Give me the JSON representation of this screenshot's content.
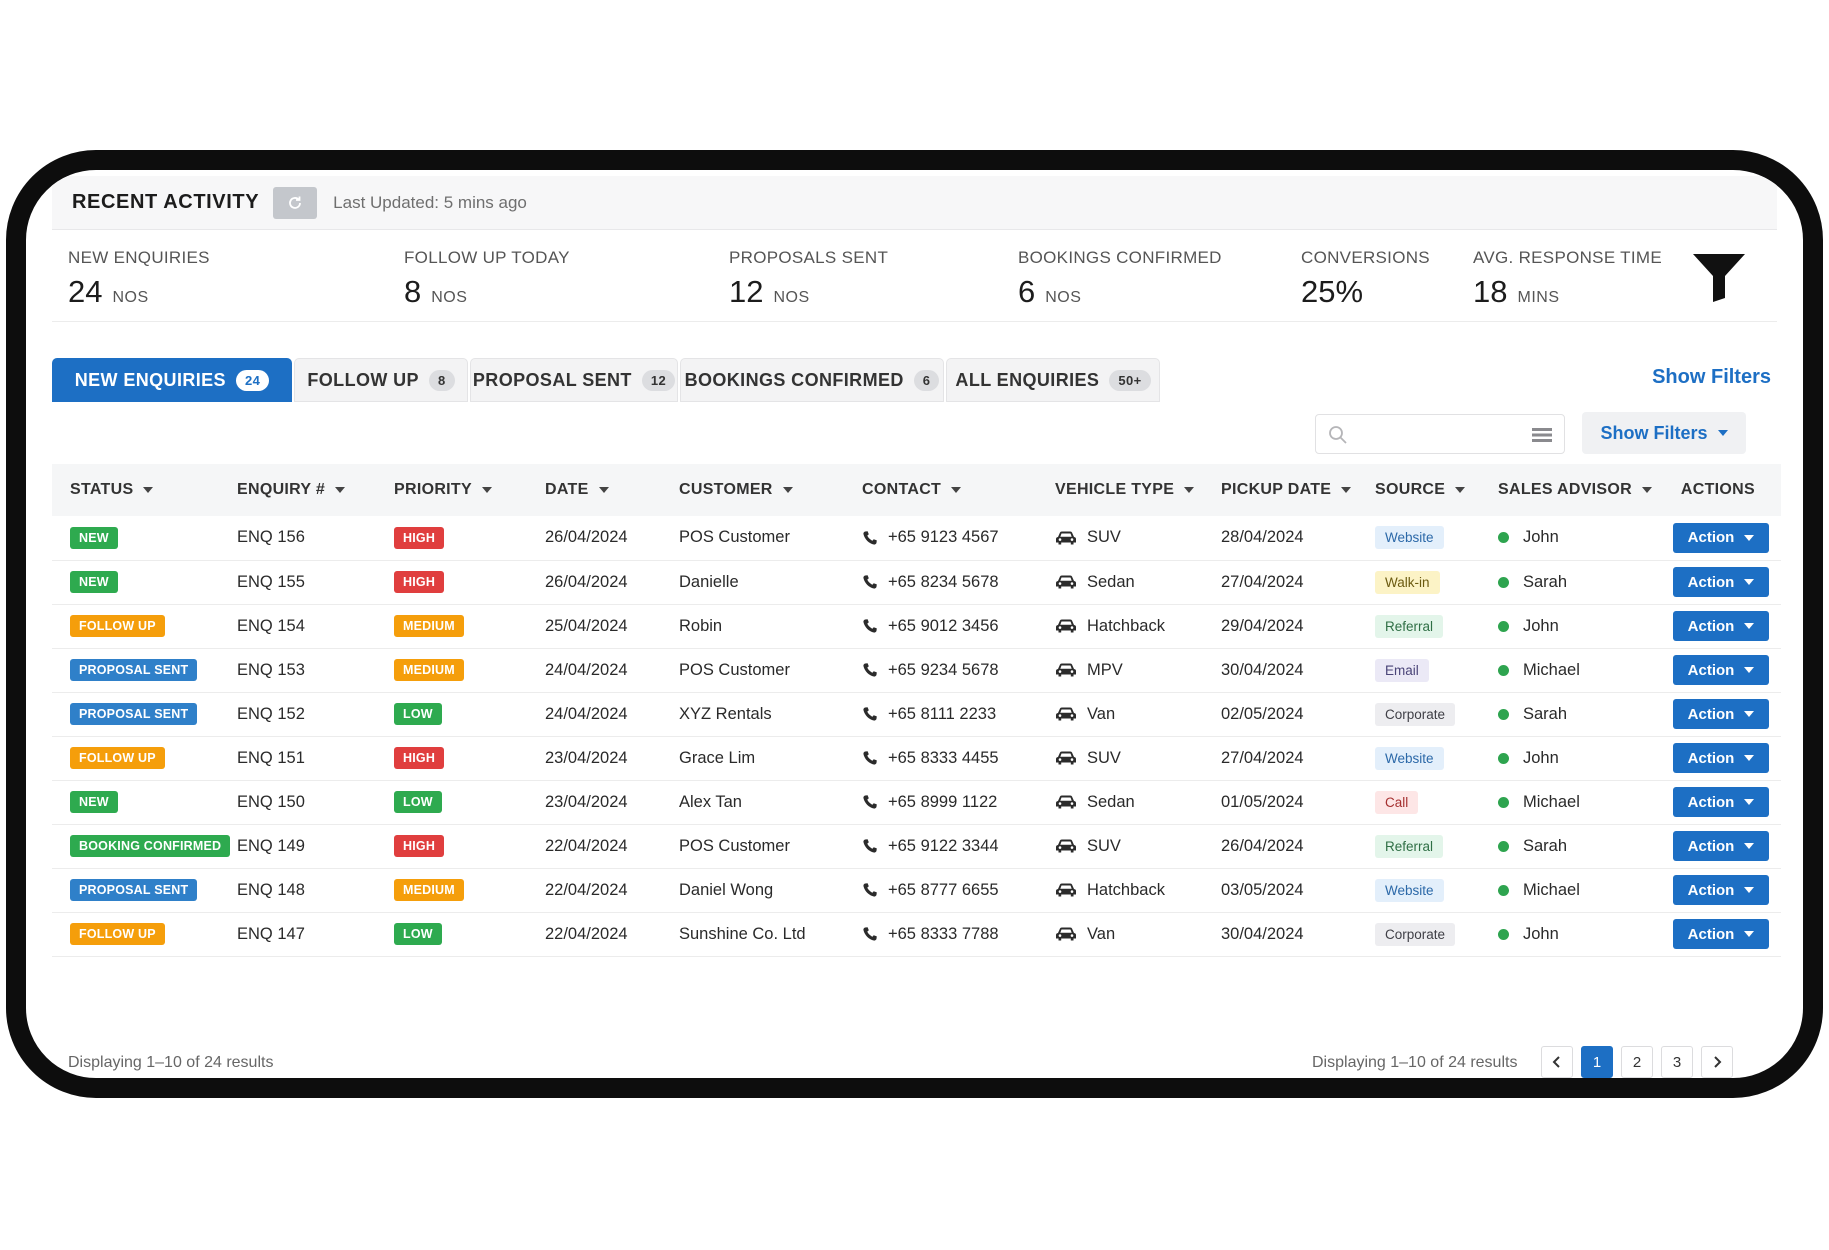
{
  "header": {
    "title": "RECENT ACTIVITY",
    "refresh_icon": "refresh-icon",
    "last_updated": "Last Updated: 5 mins ago"
  },
  "stats": [
    {
      "label": "NEW ENQUIRIES",
      "value": "24",
      "unit": "NOS"
    },
    {
      "label": "FOLLOW UP TODAY",
      "value": "8",
      "unit": "NOS"
    },
    {
      "label": "PROPOSALS SENT",
      "value": "12",
      "unit": "NOS"
    },
    {
      "label": "BOOKINGS CONFIRMED",
      "value": "6",
      "unit": "NOS"
    },
    {
      "label": "CONVERSIONS",
      "value": "25%",
      "unit": ""
    },
    {
      "label": "AVG. RESPONSE TIME",
      "value": "18",
      "unit": "MINS"
    }
  ],
  "tabs": [
    {
      "label": "NEW ENQUIRIES",
      "count": "24",
      "active": true
    },
    {
      "label": "FOLLOW UP",
      "count": "8"
    },
    {
      "label": "PROPOSAL SENT",
      "count": "12"
    },
    {
      "label": "BOOKINGS CONFIRMED",
      "count": "6"
    },
    {
      "label": "ALL ENQUIRIES",
      "count": "50+"
    }
  ],
  "toolbar": {
    "show_filters_link": "Show Filters",
    "show_filters_button": "Show Filters",
    "search_placeholder": ""
  },
  "table": {
    "columns": [
      "STATUS",
      "ENQUIRY #",
      "PRIORITY",
      "DATE",
      "CUSTOMER",
      "CONTACT",
      "VEHICLE TYPE",
      "PICKUP DATE",
      "SOURCE",
      "SALES ADVISOR",
      "ACTIONS"
    ],
    "action_label": "Action",
    "rows": [
      {
        "status": "NEW",
        "enquiry": "ENQ 156",
        "priority": "HIGH",
        "date": "26/04/2024",
        "customer": "POS Customer",
        "contact": "+65 9123 4567",
        "vehicle": "SUV",
        "pickup": "28/04/2024",
        "source": "Website",
        "advisor": "John"
      },
      {
        "status": "NEW",
        "enquiry": "ENQ 155",
        "priority": "HIGH",
        "date": "26/04/2024",
        "customer": "Danielle",
        "contact": "+65 8234 5678",
        "vehicle": "Sedan",
        "pickup": "27/04/2024",
        "source": "Walk-in",
        "advisor": "Sarah"
      },
      {
        "status": "FOLLOW UP",
        "enquiry": "ENQ 154",
        "priority": "MEDIUM",
        "date": "25/04/2024",
        "customer": "Robin",
        "contact": "+65 9012 3456",
        "vehicle": "Hatchback",
        "pickup": "29/04/2024",
        "source": "Referral",
        "advisor": "John"
      },
      {
        "status": "PROPOSAL SENT",
        "enquiry": "ENQ 153",
        "priority": "MEDIUM",
        "date": "24/04/2024",
        "customer": "POS Customer",
        "contact": "+65 9234 5678",
        "vehicle": "MPV",
        "pickup": "30/04/2024",
        "source": "Email",
        "advisor": "Michael"
      },
      {
        "status": "PROPOSAL SENT",
        "enquiry": "ENQ 152",
        "priority": "LOW",
        "date": "24/04/2024",
        "customer": "XYZ Rentals",
        "contact": "+65 8111 2233",
        "vehicle": "Van",
        "pickup": "02/05/2024",
        "source": "Corporate",
        "advisor": "Sarah"
      },
      {
        "status": "FOLLOW UP",
        "enquiry": "ENQ 151",
        "priority": "HIGH",
        "date": "23/04/2024",
        "customer": "Grace Lim",
        "contact": "+65 8333 4455",
        "vehicle": "SUV",
        "pickup": "27/04/2024",
        "source": "Website",
        "advisor": "John"
      },
      {
        "status": "NEW",
        "enquiry": "ENQ 150",
        "priority": "LOW",
        "date": "23/04/2024",
        "customer": "Alex Tan",
        "contact": "+65 8999 1122",
        "vehicle": "Sedan",
        "pickup": "01/05/2024",
        "source": "Call",
        "advisor": "Michael"
      },
      {
        "status": "BOOKING CONFIRMED",
        "enquiry": "ENQ 149",
        "priority": "HIGH",
        "date": "22/04/2024",
        "customer": "POS Customer",
        "contact": "+65 9122 3344",
        "vehicle": "SUV",
        "pickup": "26/04/2024",
        "source": "Referral",
        "advisor": "Sarah"
      },
      {
        "status": "PROPOSAL SENT",
        "enquiry": "ENQ 148",
        "priority": "MEDIUM",
        "date": "22/04/2024",
        "customer": "Daniel Wong",
        "contact": "+65 8777 6655",
        "vehicle": "Hatchback",
        "pickup": "03/05/2024",
        "source": "Website",
        "advisor": "Michael"
      },
      {
        "status": "FOLLOW UP",
        "enquiry": "ENQ 147",
        "priority": "LOW",
        "date": "22/04/2024",
        "customer": "Sunshine Co. Ltd",
        "contact": "+65 8333 7788",
        "vehicle": "Van",
        "pickup": "30/04/2024",
        "source": "Corporate",
        "advisor": "John"
      }
    ]
  },
  "footer": {
    "left_text": "Displaying 1–10 of 24 results",
    "right_text": "Displaying 1–10 of 24 results",
    "pages": [
      "1",
      "2",
      "3"
    ],
    "current_page": "1"
  },
  "colors": {
    "primary": "#1d6fc4",
    "status": {
      "NEW": "#2eaa4f",
      "FOLLOW UP": "#f59e0b",
      "PROPOSAL SENT": "#2f80c9",
      "BOOKING CONFIRMED": "#2eaa4f"
    },
    "priority": {
      "HIGH": "#e03e3e",
      "MEDIUM": "#f59e0b",
      "LOW": "#2eaa4f"
    },
    "source": {
      "Website": {
        "bg": "#e3effb",
        "fg": "#2b68a8"
      },
      "Walk-in": {
        "bg": "#fcf3c6",
        "fg": "#6b5a10"
      },
      "Referral": {
        "bg": "#e3f5ea",
        "fg": "#2f6f45"
      },
      "Email": {
        "bg": "#ebe9f6",
        "fg": "#4a4478"
      },
      "Corporate": {
        "bg": "#ededf0",
        "fg": "#3f3f46"
      },
      "Call": {
        "bg": "#fde6e6",
        "fg": "#a53030"
      }
    },
    "advisor_online": "#2ea44f"
  }
}
